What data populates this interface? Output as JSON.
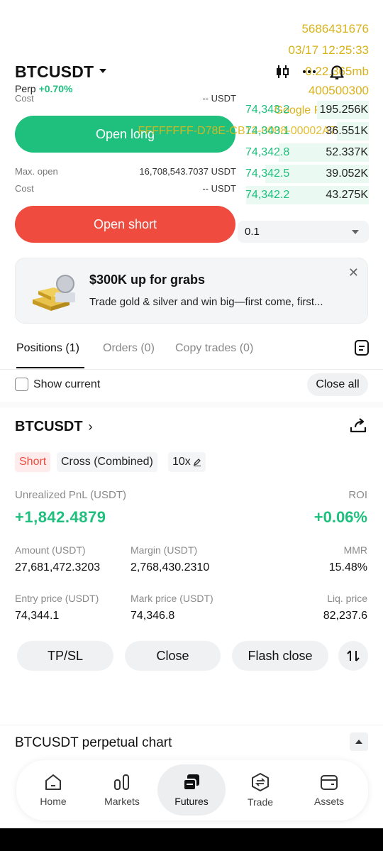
{
  "overlay": {
    "id_number": "5686431676",
    "datetime": "03/17 12:25:33",
    "coords": "0.22.365mb",
    "code": "400500300",
    "device": "Google Pixel 6 Pro",
    "guid": "FFFFFFFF-D78E-CB12-0008-00002A705FF0"
  },
  "header": {
    "symbol": "BTCUSDT",
    "contract_type": "Perp",
    "change": "+0.70%"
  },
  "form": {
    "cost_label": "Cost",
    "cost_value_long": "-- USDT",
    "open_long": "Open long",
    "max_open_label": "Max. open",
    "max_open_value": "16,708,543.7037 USDT",
    "cost_value_short": "-- USDT",
    "open_short": "Open short"
  },
  "order_book": {
    "rows": [
      {
        "price": "74,343.2",
        "qty": "195.256K",
        "depth": 0.4
      },
      {
        "price": "74,343.1",
        "qty": "36.551K",
        "depth": 0.25
      },
      {
        "price": "74,342.8",
        "qty": "52.337K",
        "depth": 0.7
      },
      {
        "price": "74,342.5",
        "qty": "39.052K",
        "depth": 0.8
      },
      {
        "price": "74,342.2",
        "qty": "43.275K",
        "depth": 0.95
      }
    ],
    "depth_value": "0.1"
  },
  "banner": {
    "title": "$300K up for grabs",
    "subtitle": "Trade gold & silver and win big—first come, first..."
  },
  "tabs": {
    "items": [
      "Positions (1)",
      "Orders (0)",
      "Copy trades (0)"
    ]
  },
  "filters": {
    "show_current": "Show current",
    "close_all": "Close all"
  },
  "position": {
    "symbol": "BTCUSDT",
    "side": "Short",
    "margin_mode": "Cross (Combined)",
    "leverage": "10x",
    "pnl_label": "Unrealized PnL (USDT)",
    "pnl_value": "+1,842.4879",
    "roi_label": "ROI",
    "roi_value": "+0.06%",
    "amount_label": "Amount (USDT)",
    "amount_value": "27,681,472.3203",
    "margin_label": "Margin (USDT)",
    "margin_value": "2,768,430.2310",
    "mmr_label": "MMR",
    "mmr_value": "15.48%",
    "entry_label": "Entry price (USDT)",
    "entry_value": "74,344.1",
    "mark_label": "Mark price (USDT)",
    "mark_value": "74,346.8",
    "liq_label": "Liq. price",
    "liq_value": "82,237.6"
  },
  "actions": {
    "tpsl": "TP/SL",
    "close": "Close",
    "flash_close": "Flash close"
  },
  "chart_section": {
    "title": "BTCUSDT perpetual chart"
  },
  "nav": {
    "items": [
      "Home",
      "Markets",
      "Futures",
      "Trade",
      "Assets"
    ],
    "active": "Futures"
  },
  "colors": {
    "long": "#1fbf7d",
    "short": "#ef4b3f",
    "overlay": "#d8b21a"
  }
}
